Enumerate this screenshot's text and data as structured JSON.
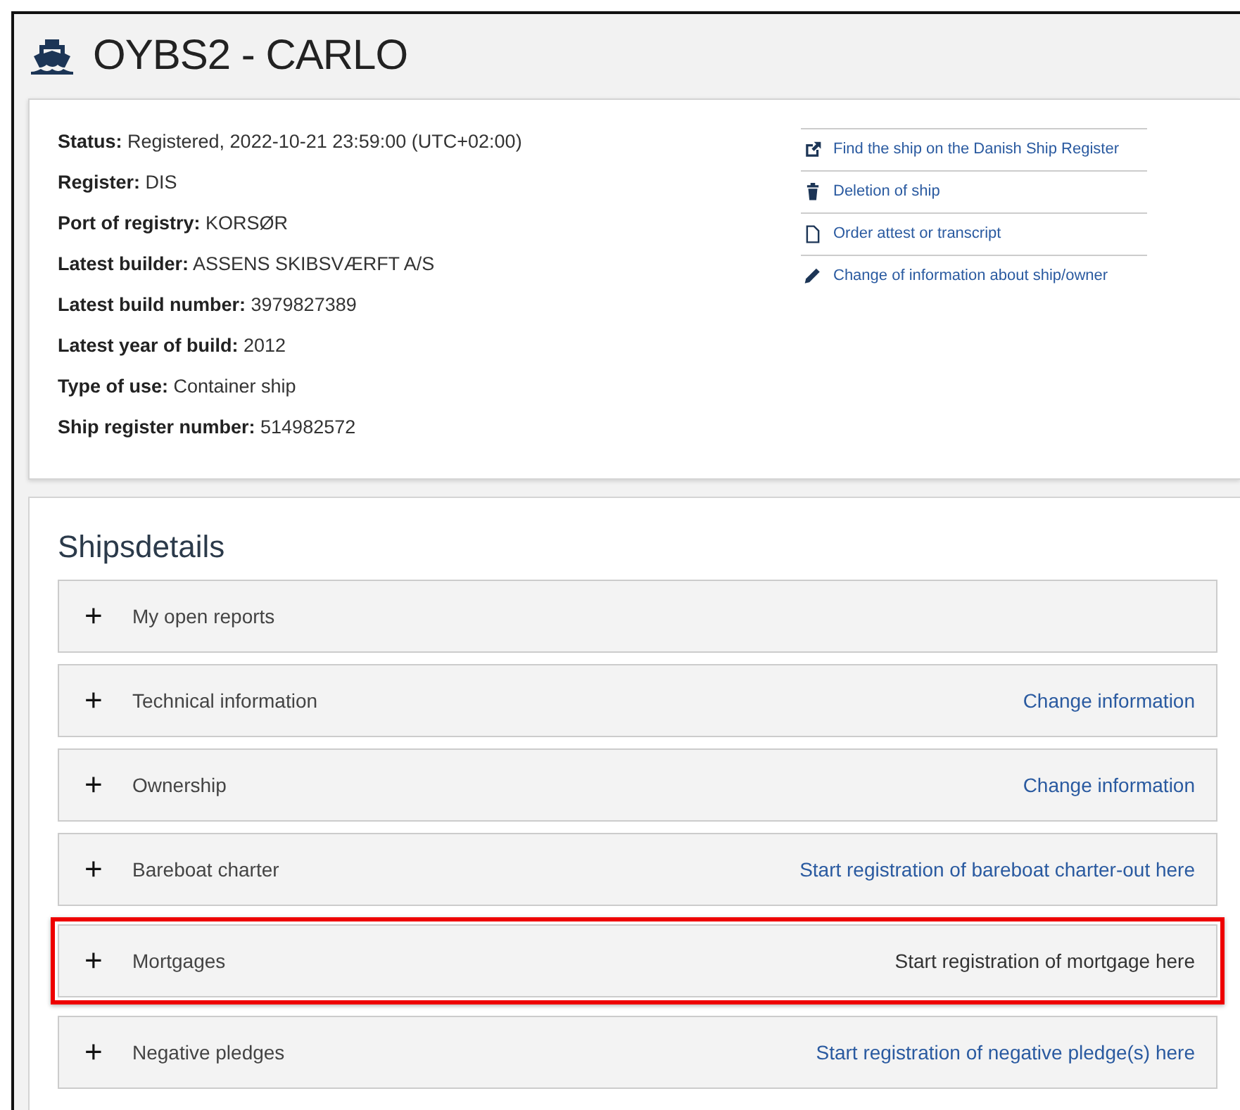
{
  "header": {
    "title": "OYBS2 - CARLO"
  },
  "info": [
    {
      "label": "Status:",
      "value": "Registered, 2022-10-21 23:59:00 (UTC+02:00)"
    },
    {
      "label": "Register:",
      "value": "DIS"
    },
    {
      "label": "Port of registry:",
      "value": "KORSØR"
    },
    {
      "label": "Latest builder:",
      "value": "ASSENS SKIBSVÆRFT A/S"
    },
    {
      "label": "Latest build number:",
      "value": "3979827389"
    },
    {
      "label": "Latest year of build:",
      "value": "2012"
    },
    {
      "label": "Type of use:",
      "value": "Container ship"
    },
    {
      "label": "Ship register number:",
      "value": "514982572"
    }
  ],
  "actions": [
    {
      "kind": "external",
      "label": "Find the ship on the Danish Ship Register"
    },
    {
      "kind": "trash",
      "label": "Deletion of ship"
    },
    {
      "kind": "file",
      "label": "Order attest or transcript"
    },
    {
      "kind": "pencil",
      "label": "Change of information about ship/owner"
    }
  ],
  "details": {
    "title": "Shipsdetails",
    "sections": [
      {
        "toggle": "+",
        "label": "My open reports",
        "expanded": false,
        "highlighted": false
      },
      {
        "toggle": "+",
        "label": "Technical information",
        "link": "Change information",
        "expanded": false,
        "highlighted": false
      },
      {
        "toggle": "+",
        "label": "Ownership",
        "link": "Change information",
        "expanded": false,
        "highlighted": false
      },
      {
        "toggle": "+",
        "label": "Bareboat charter",
        "link": "Start registration of bareboat charter-out here",
        "expanded": false,
        "highlighted": false
      },
      {
        "toggle": "+",
        "label": "Mortgages",
        "link": "Start registration of mortgage here",
        "expanded": false,
        "highlighted": true
      },
      {
        "toggle": "+",
        "label": "Negative pledges",
        "link": "Start registration of negative pledge(s) here",
        "expanded": false,
        "highlighted": false
      }
    ]
  }
}
